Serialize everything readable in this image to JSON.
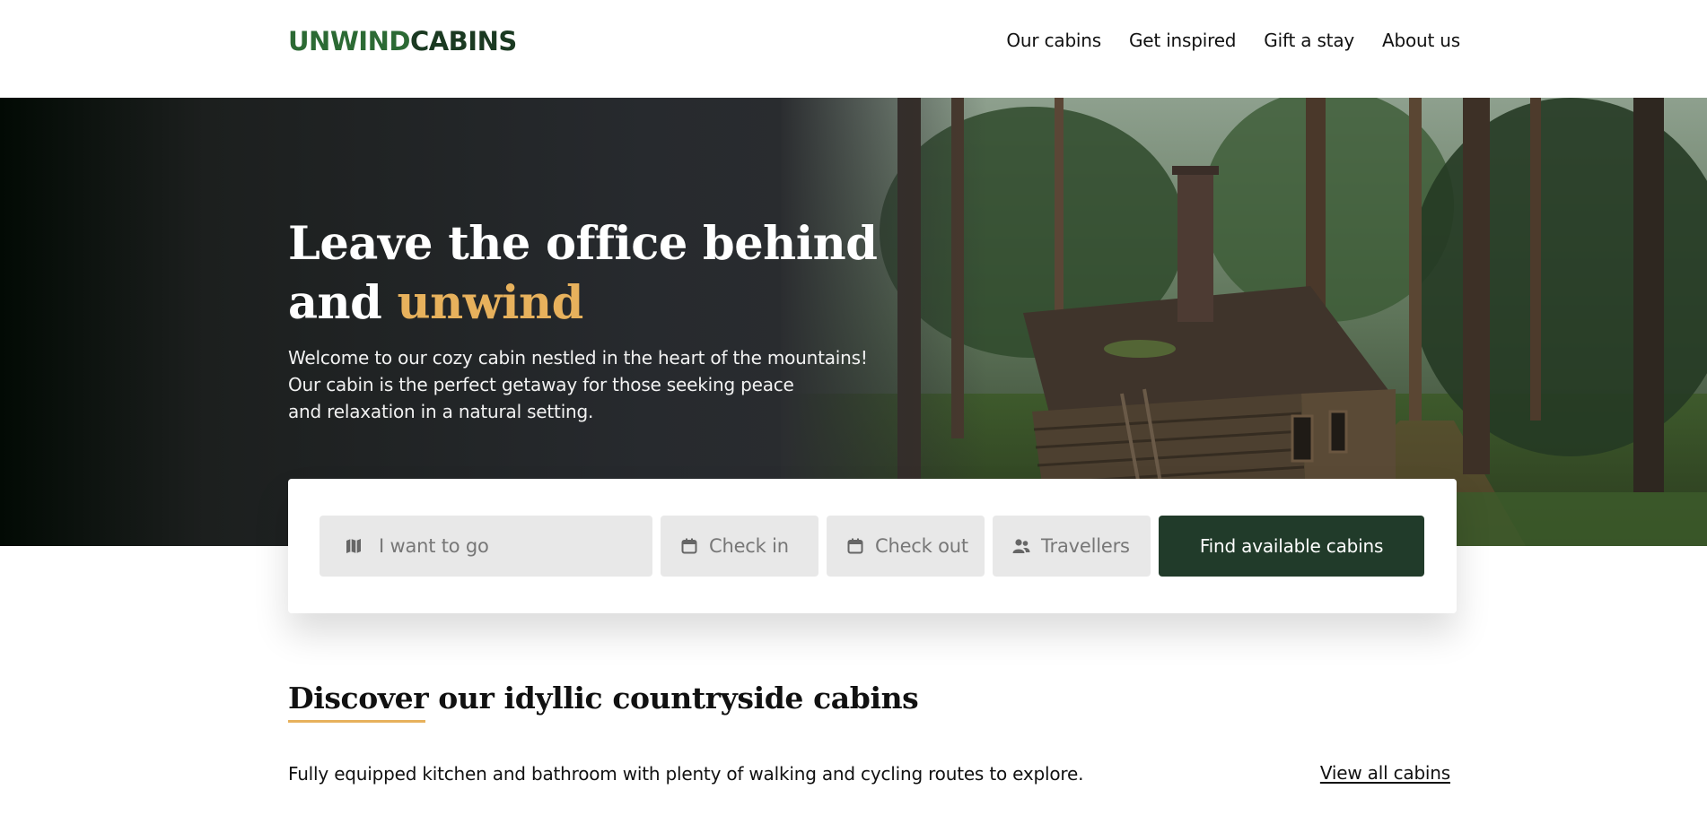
{
  "header": {
    "logo_part1": "UNWIND",
    "logo_part2": "CABINS",
    "nav": [
      {
        "label": "Our cabins"
      },
      {
        "label": "Get inspired"
      },
      {
        "label": "Gift a stay"
      },
      {
        "label": "About us"
      }
    ]
  },
  "hero": {
    "title_line1": "Leave the office behind",
    "title_line2_prefix": "and ",
    "title_line2_accent": "unwind",
    "subtitle_line1": "Welcome to our cozy cabin nestled in the heart of the mountains!",
    "subtitle_line2": "Our cabin is the perfect getaway for those seeking peace",
    "subtitle_line3": "and relaxation in a natural setting."
  },
  "search": {
    "destination_placeholder": "I want to go",
    "checkin_placeholder": "Check in",
    "checkout_placeholder": "Check out",
    "travellers_placeholder": "Travellers",
    "submit_label": "Find available cabins",
    "icons": {
      "destination": "map-icon",
      "checkin": "calendar-icon",
      "checkout": "calendar-icon",
      "travellers": "users-icon"
    }
  },
  "discover": {
    "title": "Discover our idyllic countryside cabins",
    "description": "Fully equipped kitchen and bathroom with plenty of walking and cycling routes to explore.",
    "view_all_label": "View all cabins"
  },
  "colors": {
    "brand_green": "#2c6a34",
    "brand_dark_green": "#213b2a",
    "accent_gold": "#e7b15c"
  }
}
